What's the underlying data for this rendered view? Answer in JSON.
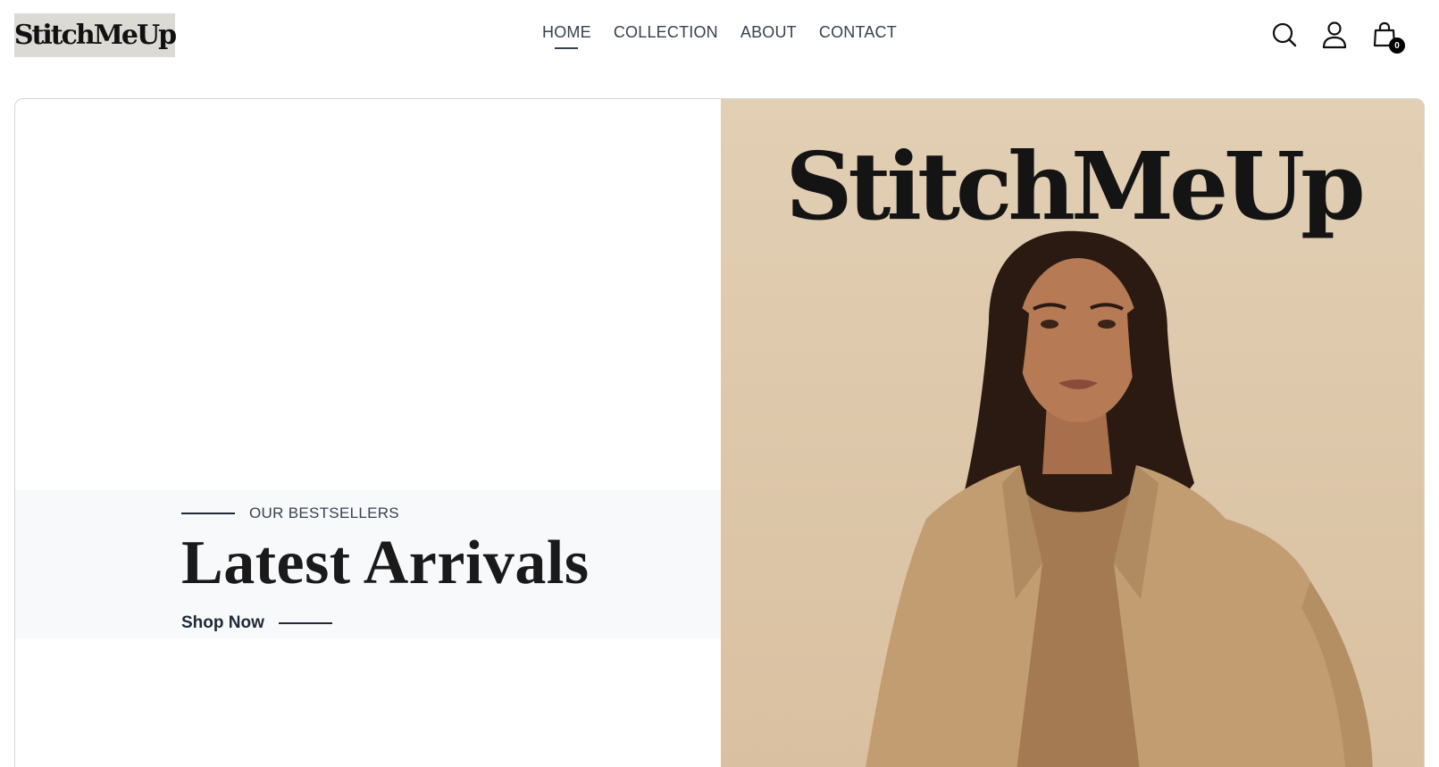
{
  "header": {
    "logo_text": "StitchMeUp",
    "nav": [
      {
        "label": "HOME",
        "active": true
      },
      {
        "label": "COLLECTION",
        "active": false
      },
      {
        "label": "ABOUT",
        "active": false
      },
      {
        "label": "CONTACT",
        "active": false
      }
    ],
    "icons": [
      "search-icon",
      "user-icon",
      "shopping-bag-icon"
    ],
    "cart_count": "0"
  },
  "hero": {
    "eyebrow": "OUR BESTSELLERS",
    "title": "Latest Arrivals",
    "cta": "Shop Now",
    "brand_text": "StitchMeUp",
    "image_background_color": "#e0cbaf"
  },
  "colors": {
    "text": "#1f2937",
    "band": "#f8f9fb",
    "logo_bg": "#dcdad5"
  }
}
